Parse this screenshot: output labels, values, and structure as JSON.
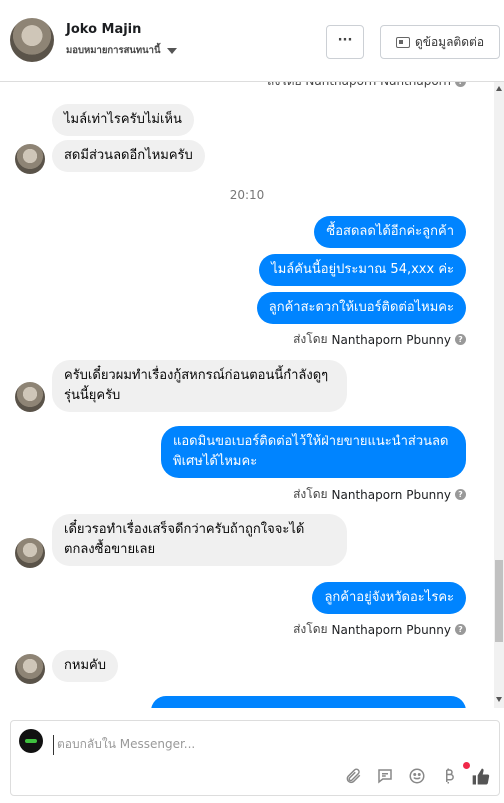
{
  "header": {
    "name": "Joko Majin",
    "subtitle": "มอบหมายการสนทนานี้",
    "more_label": "···",
    "contact_label": "ดูข้อมูลติดต่อ"
  },
  "thread": {
    "top_partial": "ส่งโดย Nanthaporn Nanthaporn",
    "incoming_1": "ไมล์เท่าไรครับไม่เห็น",
    "incoming_2": "สดมีส่วนลดอีกไหมครับ",
    "time": "20:10",
    "outgoing_1": "ซื้อสดลดได้อีกค่ะลูกค้า",
    "outgoing_2": "ไมล์คันนี้อยู่ประมาณ 54,xxx ค่ะ",
    "outgoing_3": "ลูกค้าสะดวกให้เบอร์ติดต่อไหมคะ",
    "sent_by_label": "ส่งโดย",
    "sent_by_name": "Nanthaporn Pbunny",
    "incoming_3_line1": "ครับเดี๋ยวผมทำเรื่องกู้สหกรณ์ก่อนตอนนี้กำลังดูๆ",
    "incoming_3_line2": "รุ่นนี้ยุครับ",
    "outgoing_4_line1": "แอดมินขอเบอร์ติดต่อไว้ให้ฝ่ายขายแนะนำส่วนลด",
    "outgoing_4_line2": "พิเศษได้ไหมคะ",
    "incoming_4_line1": "เดี๋ยวรอทำเรื่องเสร็จดีกว่าครับถ้าถูกใจจะได้",
    "incoming_4_line2": "ตกลงซื้อขายเลย",
    "outgoing_5": "ลูกค้าอยู่จังหวัดอะไรคะ",
    "incoming_5": "กหมคับ"
  },
  "composer": {
    "placeholder": "ตอบกลับใน Messenger..."
  },
  "colors": {
    "outgoing_bubble": "#0084ff",
    "incoming_bubble": "#f0f0f0"
  }
}
